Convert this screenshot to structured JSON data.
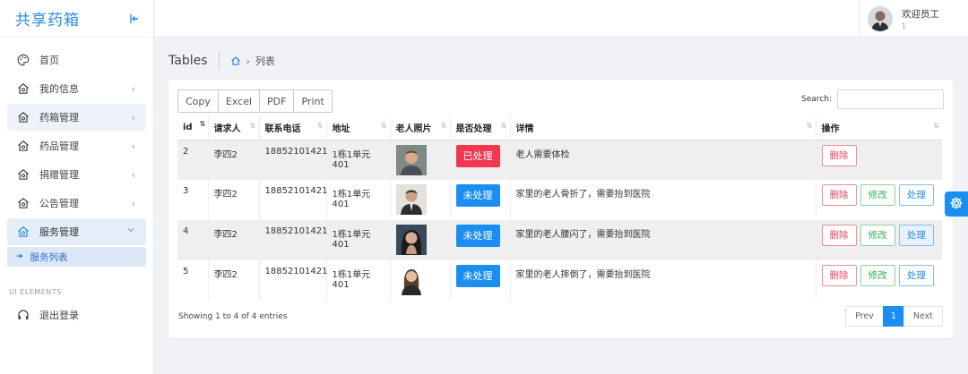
{
  "sidebar": {
    "brand": "共享药箱",
    "items": [
      {
        "label": "首页"
      },
      {
        "label": "我的信息"
      },
      {
        "label": "药箱管理"
      },
      {
        "label": "药品管理"
      },
      {
        "label": "捐赠管理"
      },
      {
        "label": "公告管理"
      },
      {
        "label": "服务管理"
      }
    ],
    "sub_item": "服务列表",
    "section_label": "UI ELEMENTS",
    "logout": "退出登录"
  },
  "user": {
    "greeting": "欢迎员工",
    "sub": "1"
  },
  "breadcrumb": {
    "title": "Tables",
    "current": "列表"
  },
  "toolbar": {
    "copy": "Copy",
    "excel": "Excel",
    "pdf": "PDF",
    "print": "Print"
  },
  "search": {
    "label": "Search:",
    "value": ""
  },
  "table": {
    "headers": [
      "id",
      "请求人",
      "联系电话",
      "地址",
      "老人照片",
      "是否处理",
      "详情",
      "操作"
    ],
    "rows": [
      {
        "id": "2",
        "requester": "李四2",
        "phone": "18852101421",
        "address": "1栋1单元401",
        "status": "已处理",
        "detail": "老人需要体检"
      },
      {
        "id": "3",
        "requester": "李四2",
        "phone": "18852101421",
        "address": "1栋1单元401",
        "status": "未处理",
        "detail": "家里的老人骨折了，需要抬到医院"
      },
      {
        "id": "4",
        "requester": "李四2",
        "phone": "18852101421",
        "address": "1栋1单元401",
        "status": "未处理",
        "detail": "家里的老人腰闪了，需要抬到医院"
      },
      {
        "id": "5",
        "requester": "李四2",
        "phone": "18852101421",
        "address": "1栋1单元401",
        "status": "未处理",
        "detail": "家里的老人摔倒了，需要抬到医院"
      }
    ],
    "actions": {
      "delete": "删除",
      "edit": "修改",
      "process": "处理"
    }
  },
  "footer": {
    "info": "Showing 1 to 4 of 4 entries",
    "prev": "Prev",
    "page": "1",
    "next": "Next"
  },
  "colors": {
    "accent": "#1b8ff1",
    "danger": "#f2384f",
    "success": "#37b24d"
  }
}
